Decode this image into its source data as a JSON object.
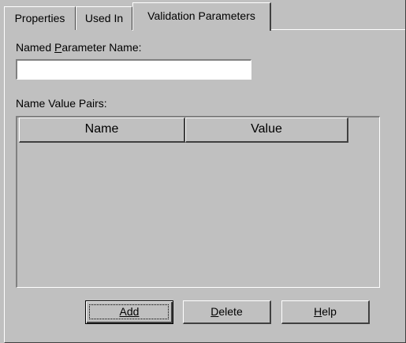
{
  "tabs": [
    {
      "label": "Properties",
      "active": false
    },
    {
      "label": "Used In",
      "active": false
    },
    {
      "label": "Validation Parameters",
      "active": true
    }
  ],
  "form": {
    "parameter_label_before": "Named ",
    "parameter_label_accel": "P",
    "parameter_label_after": "arameter Name:",
    "parameter_value": "",
    "pairs_label": "Name Value Pairs:"
  },
  "grid": {
    "columns": [
      "Name",
      "Value"
    ],
    "rows": []
  },
  "buttons": {
    "add": "Add",
    "delete_accel": "D",
    "delete_rest": "elete",
    "help_accel": "H",
    "help_rest": "elp"
  },
  "colors": {
    "face": "#c0c0c0",
    "highlight": "#ffffff",
    "shadow": "#808080",
    "dark_shadow": "#404040",
    "input_background": "#ffffff"
  }
}
